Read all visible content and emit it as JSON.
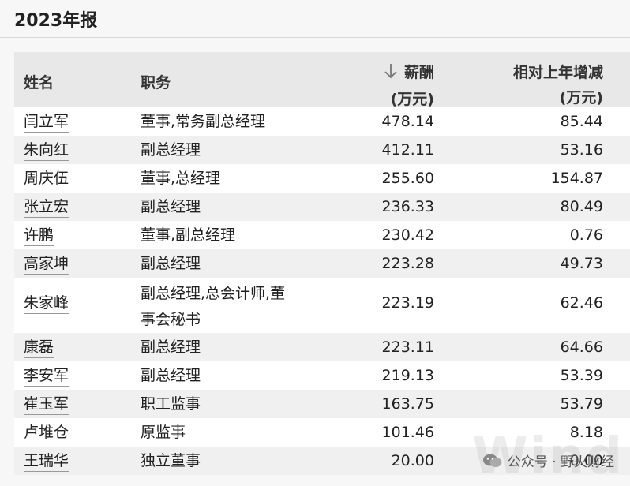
{
  "page": {
    "title": "2023年报"
  },
  "table": {
    "headers": {
      "name": "姓名",
      "role": "职务",
      "salary_line1": "薪酬",
      "salary_line2": "(万元)",
      "change_line1": "相对上年增减",
      "change_line2": "(万元)"
    },
    "sort_icon": "down-arrow-icon",
    "rows": [
      {
        "name": "闫立军",
        "role": "董事,常务副总经理",
        "salary": "478.14",
        "change": "85.44"
      },
      {
        "name": "朱向红",
        "role": "副总经理",
        "salary": "412.11",
        "change": "53.16"
      },
      {
        "name": "周庆伍",
        "role": "董事,总经理",
        "salary": "255.60",
        "change": "154.87"
      },
      {
        "name": "张立宏",
        "role": "副总经理",
        "salary": "236.33",
        "change": "80.49"
      },
      {
        "name": "许鹏",
        "role": "董事,副总经理",
        "salary": "230.42",
        "change": "0.76"
      },
      {
        "name": "高家坤",
        "role": "副总经理",
        "salary": "223.28",
        "change": "49.73"
      },
      {
        "name": "朱家峰",
        "role_line1": "副总经理,总会计师,董",
        "role_line2": "事会秘书",
        "salary": "223.19",
        "change": "62.46"
      },
      {
        "name": "康磊",
        "role": "副总经理",
        "salary": "223.11",
        "change": "64.66"
      },
      {
        "name": "李安军",
        "role": "副总经理",
        "salary": "219.13",
        "change": "53.39"
      },
      {
        "name": "崔玉军",
        "role": "职工监事",
        "salary": "163.75",
        "change": "53.79"
      },
      {
        "name": "卢堆仓",
        "role": "原监事",
        "salary": "101.46",
        "change": "8.18"
      },
      {
        "name": "王瑞华",
        "role": "独立董事",
        "salary": "20.00",
        "change": "0.00"
      }
    ]
  },
  "watermark": {
    "text": "公众号 · 野火财经",
    "icon": "wechat-icon",
    "bg_text": "Wind"
  }
}
